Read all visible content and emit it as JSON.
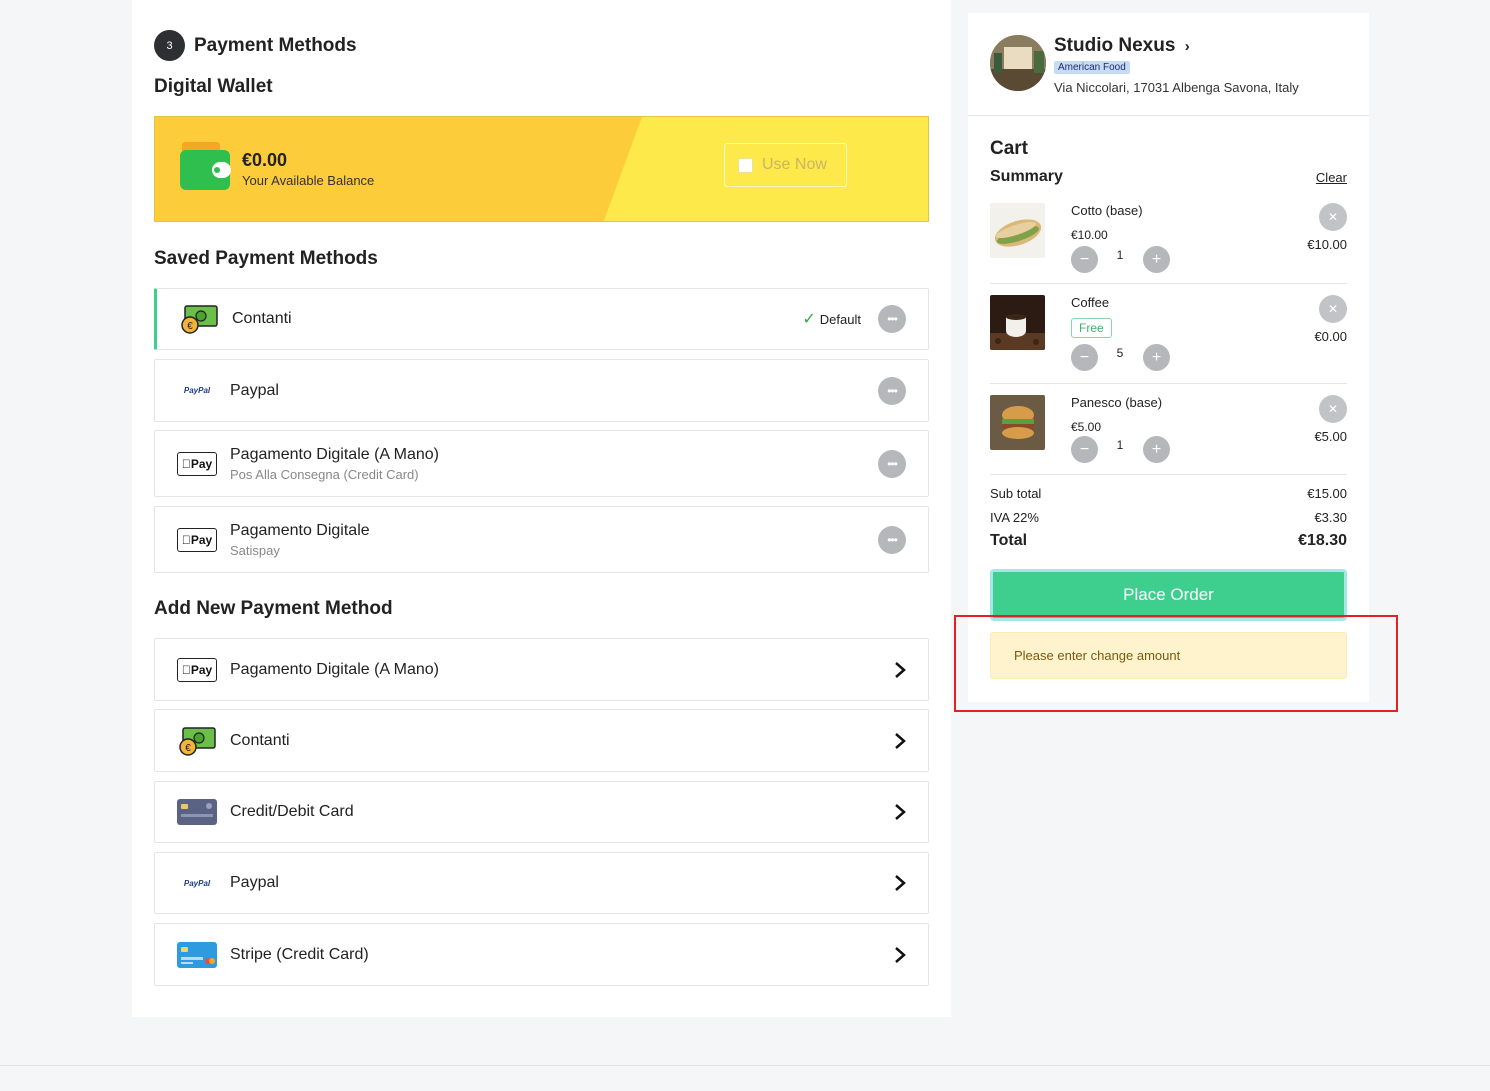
{
  "step": {
    "number": "3",
    "title": "Payment Methods"
  },
  "wallet": {
    "section_title": "Digital Wallet",
    "amount": "€0.00",
    "subtitle": "Your Available Balance",
    "use_now": "Use Now",
    "colors": {
      "left": "#fdcc3b",
      "right": "#fee94a"
    }
  },
  "saved": {
    "title": "Saved Payment Methods",
    "default_label": "Default",
    "items": [
      {
        "label": "Contanti",
        "icon": "cash-icon",
        "default": true
      },
      {
        "label": "Paypal",
        "icon": "paypal-icon"
      },
      {
        "label": "Pagamento Digitale (A Mano)",
        "sub": "Pos Alla Consegna (Credit Card)",
        "icon": "apple-pay-icon"
      },
      {
        "label": "Pagamento Digitale",
        "sub": "Satispay",
        "icon": "apple-pay-icon"
      }
    ]
  },
  "add_new": {
    "title": "Add New Payment Method",
    "items": [
      {
        "label": "Pagamento Digitale (A Mano)",
        "icon": "apple-pay-icon"
      },
      {
        "label": "Contanti",
        "icon": "cash-icon"
      },
      {
        "label": "Credit/Debit Card",
        "icon": "credit-card-icon"
      },
      {
        "label": "Paypal",
        "icon": "paypal-icon"
      },
      {
        "label": "Stripe (Credit Card)",
        "icon": "stripe-card-icon"
      }
    ]
  },
  "icons": {
    "pay_text": "Pay",
    "paypal_text": "PayPal"
  },
  "restaurant": {
    "name": "Studio Nexus",
    "category": "American Food",
    "address": "Via Niccolari, 17031 Albenga Savona, Italy"
  },
  "cart": {
    "title": "Cart",
    "summary": "Summary",
    "clear": "Clear",
    "items": [
      {
        "name": "Cotto (base)",
        "price": "€10.00",
        "qty": "1",
        "total": "€10.00"
      },
      {
        "name": "Coffee",
        "price": "Free",
        "qty": "5",
        "total": "€0.00"
      },
      {
        "name": "Panesco (base)",
        "price": "€5.00",
        "qty": "1",
        "total": "€5.00"
      }
    ],
    "subtotal_label": "Sub total",
    "subtotal": "€15.00",
    "tax_label": "IVA 22%",
    "tax": "€3.30",
    "total_label": "Total",
    "total": "€18.30",
    "place_order": "Place Order",
    "alert": "Please enter change amount"
  },
  "colors": {
    "accent": "#3ecf8e",
    "alert_bg": "#fef3cd",
    "highlight": "#e32124"
  }
}
